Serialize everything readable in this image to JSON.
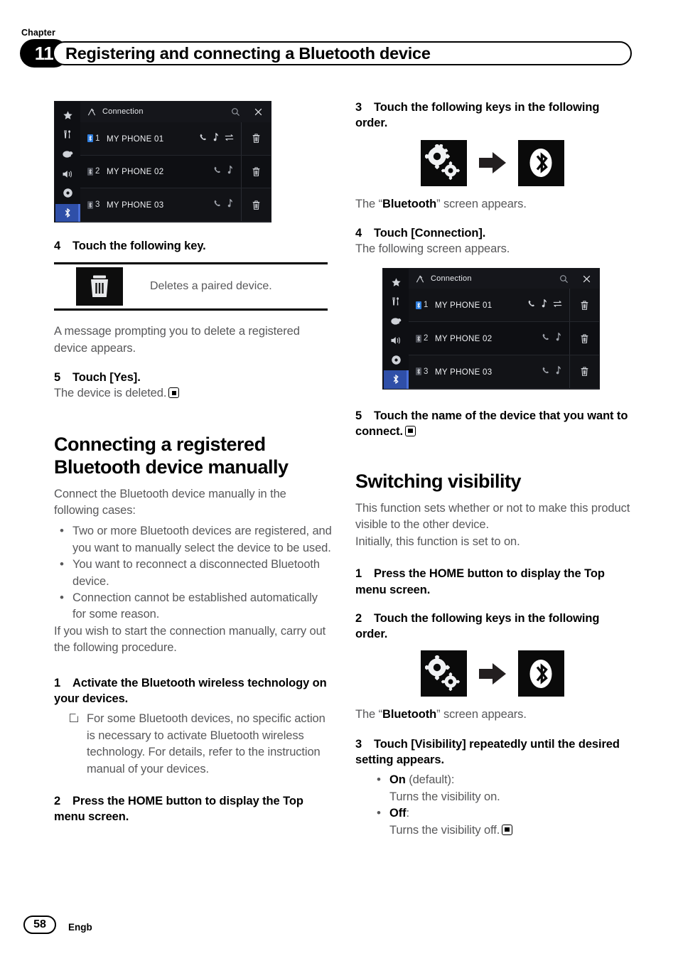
{
  "header": {
    "chapter_label": "Chapter",
    "chapter_number": "11",
    "title": "Registering and connecting a Bluetooth device"
  },
  "footer": {
    "page_number": "58",
    "language_code": "Engb"
  },
  "device_screen": {
    "title": "Connection",
    "sidebar_icons": [
      "star-icon",
      "tools-icon",
      "palette-icon",
      "speaker-icon",
      "disc-icon",
      "bluetooth-icon"
    ],
    "bar_icons": [
      "back-icon",
      "search-icon",
      "close-icon"
    ],
    "rows": [
      {
        "index": "1",
        "name": "MY PHONE 01",
        "icons": [
          "phone-icon",
          "music-note-icon",
          "transfer-icon"
        ],
        "trash": "trash-icon"
      },
      {
        "index": "2",
        "name": "MY PHONE 02",
        "icons": [
          "phone-icon",
          "music-note-icon"
        ],
        "trash": "trash-icon"
      },
      {
        "index": "3",
        "name": "MY PHONE 03",
        "icons": [
          "phone-icon",
          "music-note-icon"
        ],
        "trash": "trash-icon"
      }
    ]
  },
  "left_column": {
    "step4_num": "4",
    "step4_text": "Touch the following key.",
    "key_table_desc": "Deletes a paired device.",
    "after_key_text": "A message prompting you to delete a registered device appears.",
    "step5_num": "5",
    "step5_text": "Touch [Yes].",
    "step5_result": "The device is deleted.",
    "heading": "Connecting a registered Bluetooth device manually",
    "intro": "Connect the Bluetooth device manually in the following cases:",
    "bullets": [
      "Two or more Bluetooth devices are registered, and you want to manually select the device to be used.",
      "You want to reconnect a disconnected Bluetooth device.",
      "Connection cannot be established automatically for some reason."
    ],
    "outro": "If you wish to start the connection manually, carry out the following procedure.",
    "step1_num": "1",
    "step1_text": "Activate the Bluetooth wireless technology on your devices.",
    "step1_note": "For some Bluetooth devices, no specific action is necessary to activate Bluetooth wireless technology. For details, refer to the instruction manual of your devices.",
    "step2_num": "2",
    "step2_text": "Press the HOME button to display the Top menu screen."
  },
  "right_column": {
    "step3_num": "3",
    "step3_text": "Touch the following keys in the following order.",
    "keys": {
      "first": "settings-gears-icon",
      "arrow": "arrow-right-icon",
      "second": "bluetooth-icon"
    },
    "step3_result_pre": "The “",
    "step3_result_bold": "Bluetooth",
    "step3_result_post": "” screen appears.",
    "step4_num": "4",
    "step4_text": "Touch [Connection].",
    "step4_result": "The following screen appears.",
    "step5_num": "5",
    "step5_text": "Touch the name of the device that you want to connect.",
    "heading": "Switching visibility",
    "desc_line1": "This function sets whether or not to make this product visible to the other device.",
    "desc_line2": "Initially, this function is set to on.",
    "vis_step1_num": "1",
    "vis_step1_text": "Press the HOME button to display the Top menu screen.",
    "vis_step2_num": "2",
    "vis_step2_text": "Touch the following keys in the following order.",
    "vis_result_pre": "The “",
    "vis_result_bold": "Bluetooth",
    "vis_result_post": "” screen appears.",
    "vis_step3_num": "3",
    "vis_step3_text": "Touch [Visibility] repeatedly until the desired setting appears.",
    "vis_options": [
      {
        "label": "On",
        "suffix": " (default):",
        "desc": "Turns the visibility on."
      },
      {
        "label": "Off",
        "suffix": ":",
        "desc": "Turns the visibility off."
      }
    ]
  },
  "colors": {
    "body_text": "#58585a",
    "heading": "#000000",
    "screen_bg": "#0b0c10",
    "accent_blue": "#2f4fa8"
  }
}
